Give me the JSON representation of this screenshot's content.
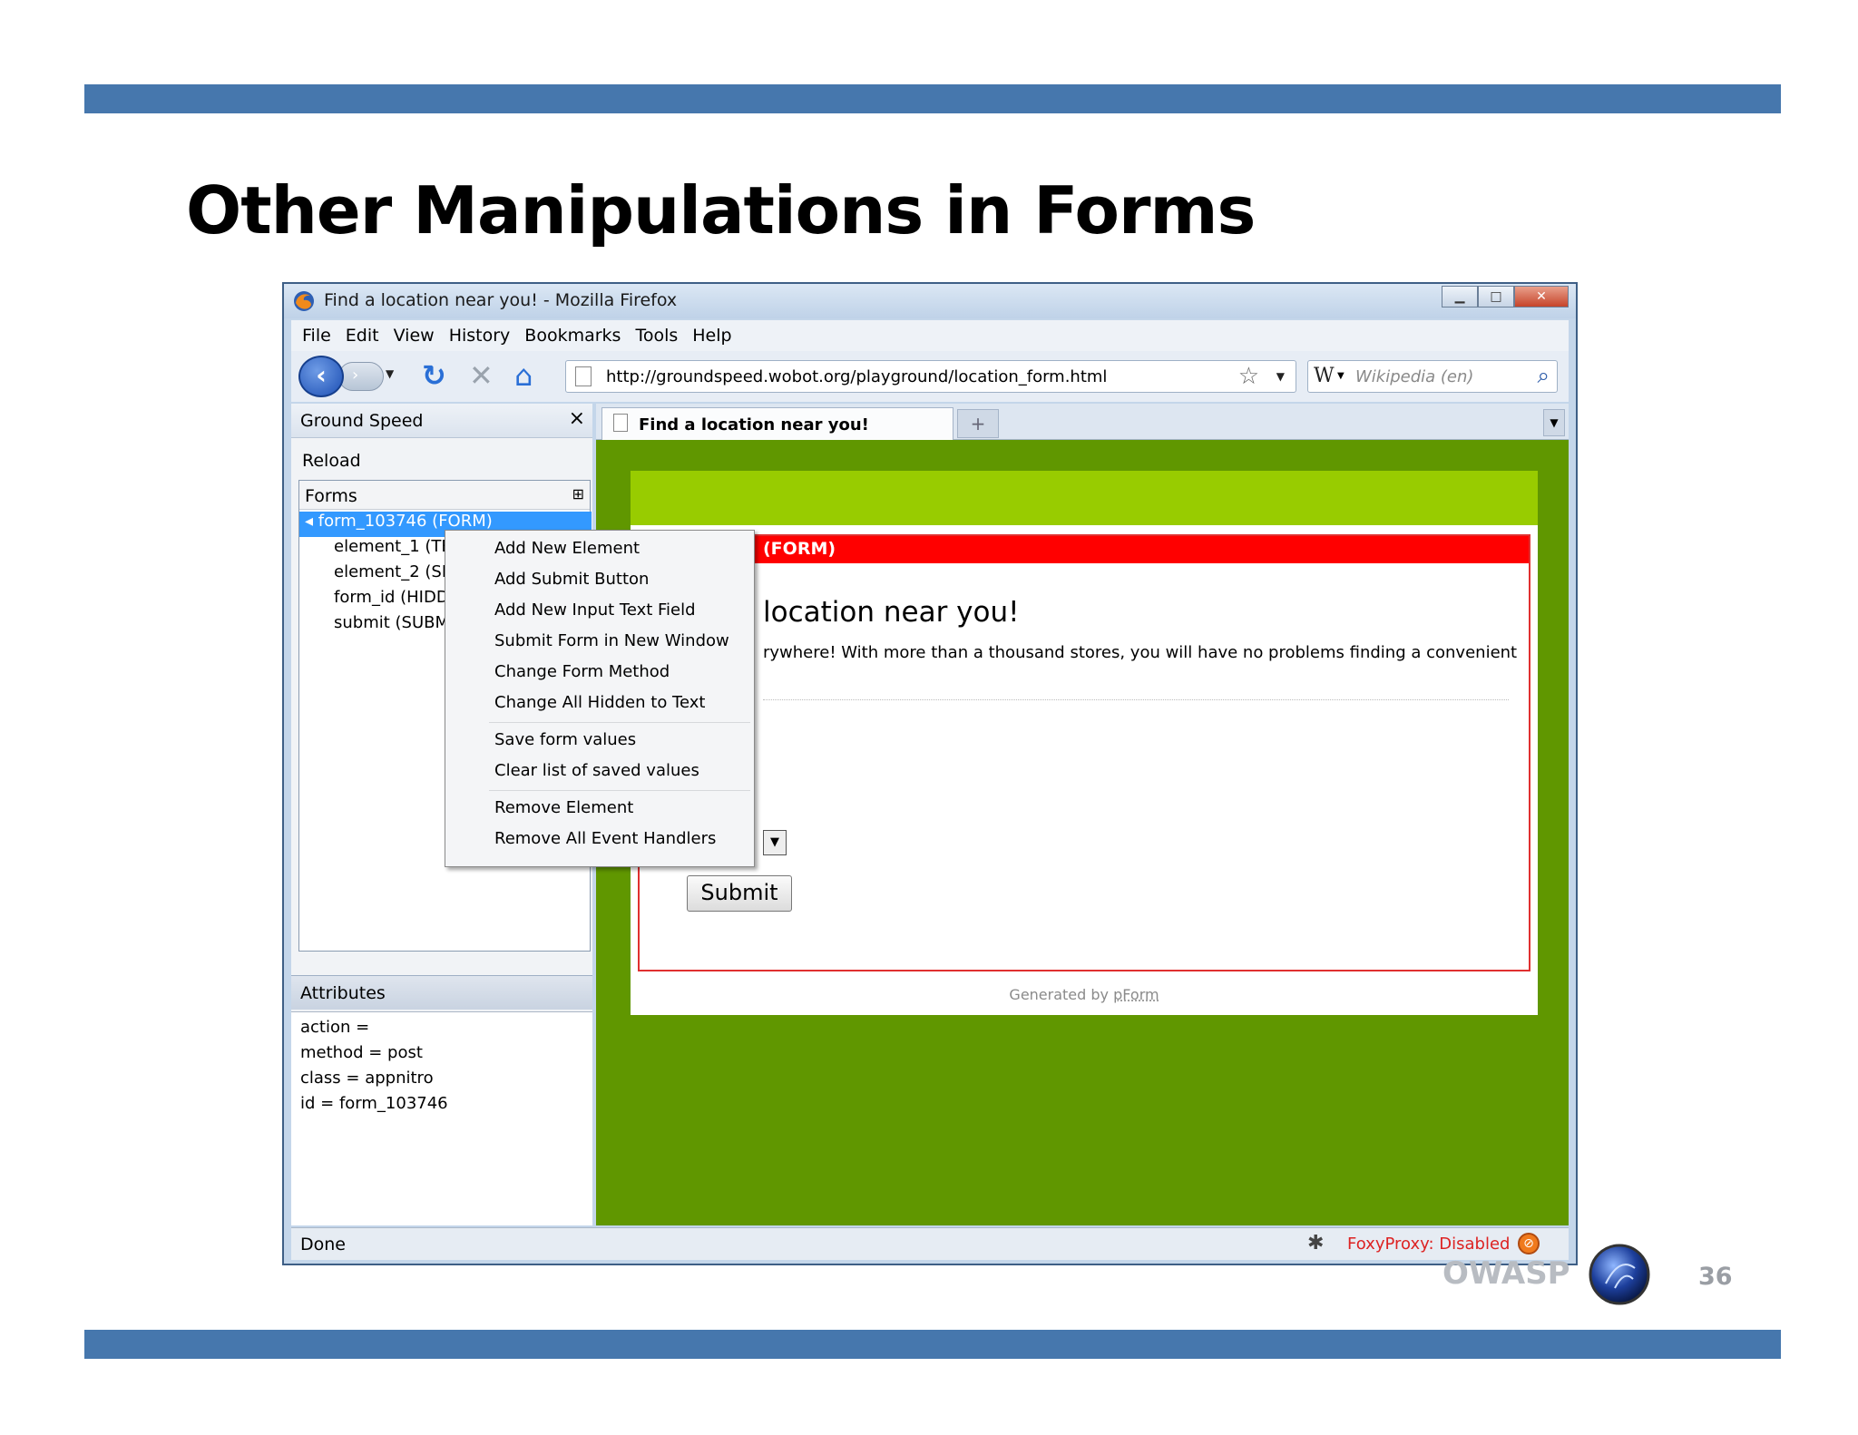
{
  "slide": {
    "title": "Other Manipulations in Forms",
    "brand": "OWASP",
    "page_number": "36"
  },
  "window": {
    "title": "Find a location near you! - Mozilla Firefox",
    "menu": [
      {
        "label": "File"
      },
      {
        "label": "Edit"
      },
      {
        "label": "View"
      },
      {
        "label": "History"
      },
      {
        "label": "Bookmarks"
      },
      {
        "label": "Tools"
      },
      {
        "label": "Help"
      }
    ],
    "url": "http://groundspeed.wobot.org/playground/location_form.html",
    "search_placeholder": "Wikipedia (en)",
    "search_engine_icon": "W"
  },
  "sidebar": {
    "title": "Ground Speed",
    "reload": "Reload",
    "forms_label": "Forms",
    "tree": {
      "form": "form_103746 (FORM)",
      "children": [
        "element_1 (TEXT)",
        "element_2 (SELECT)",
        "form_id (HIDDEN)",
        "submit (SUBMIT)"
      ]
    },
    "attributes_label": "Attributes",
    "attributes": [
      "action =",
      "method = post",
      "class = appnitro",
      "id = form_103746"
    ]
  },
  "tab": {
    "label": "Find a location near you!",
    "new_tab_symbol": "+"
  },
  "page": {
    "form_label": "(FORM)",
    "heading": "location near you!",
    "description": "rywhere! With more than a thousand stores, you will have no problems finding a convenient",
    "submit_label": "Submit",
    "generated_prefix": "Generated by",
    "generated_link": "pForm"
  },
  "context_menu": {
    "group1": [
      "Add New Element",
      "Add Submit Button",
      "Add New Input Text Field",
      "Submit Form in New Window",
      "Change Form Method",
      "Change All Hidden to Text"
    ],
    "group2": [
      "Save form values",
      "Clear list of saved values"
    ],
    "group3": [
      "Remove Element",
      "Remove All Event Handlers"
    ]
  },
  "statusbar": {
    "status": "Done",
    "proxy": "FoxyProxy: Disabled"
  },
  "colors": {
    "slide_bar": "#4677ad",
    "page_bg": "#609700",
    "page_header": "#98cc00",
    "form_label_bg": "#ff0000"
  }
}
